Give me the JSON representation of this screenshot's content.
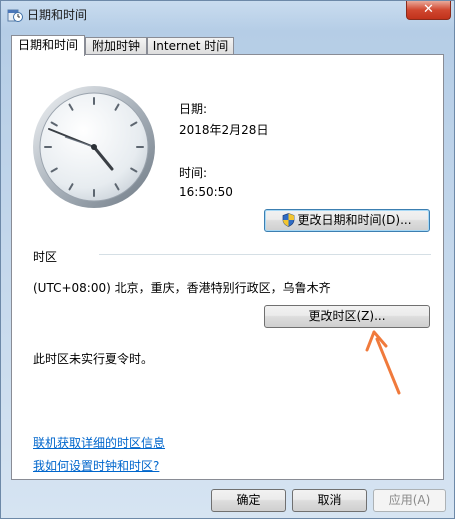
{
  "window": {
    "title": "日期和时间",
    "close_symbol": "✕"
  },
  "tabs": [
    {
      "label": "日期和时间",
      "active": true
    },
    {
      "label": "附加时钟",
      "active": false
    },
    {
      "label": "Internet 时间",
      "active": false
    }
  ],
  "datetime": {
    "date_label": "日期:",
    "date_value": "2018年2月28日",
    "time_label": "时间:",
    "time_value": "16:50:50",
    "change_datetime_button": "更改日期和时间(D)..."
  },
  "timezone": {
    "section_label": "时区",
    "value": "(UTC+08:00) 北京，重庆，香港特别行政区，乌鲁木齐",
    "change_timezone_button": "更改时区(Z)...",
    "dst_note": "此时区未实行夏令时。"
  },
  "links": {
    "online_info": "联机获取详细的时区信息",
    "how_to_set": "我如何设置时钟和时区?"
  },
  "footer": {
    "ok": "确定",
    "cancel": "取消",
    "apply": "应用(A)"
  },
  "icons": {
    "window_icon": "clock-calendar-icon",
    "uac_shield": "uac-shield-icon",
    "annotation": "arrow-annotation-icon"
  },
  "colors": {
    "link": "#0066cc",
    "arrow": "#f07a3c"
  }
}
